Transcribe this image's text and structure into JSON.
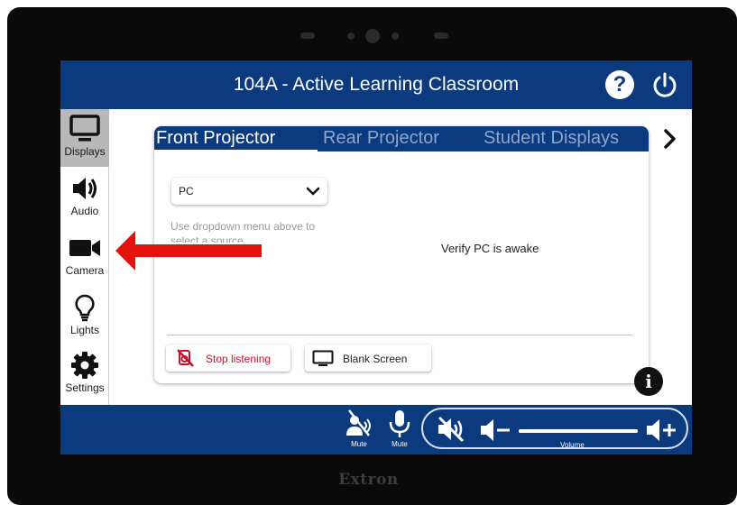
{
  "device": {
    "brand": "Extron"
  },
  "header": {
    "title": "104A - Active Learning Classroom",
    "help_label": "?"
  },
  "sidebar": {
    "items": [
      {
        "label": "Displays",
        "icon": "monitor-icon",
        "active": true
      },
      {
        "label": "Audio",
        "icon": "speaker-icon",
        "active": false
      },
      {
        "label": "Camera",
        "icon": "video-camera-icon",
        "active": false
      },
      {
        "label": "Lights",
        "icon": "lightbulb-icon",
        "active": false
      },
      {
        "label": "Settings",
        "icon": "gear-icon",
        "active": false
      }
    ]
  },
  "display_tabs": [
    {
      "label": "Front Projector",
      "active": true
    },
    {
      "label": "Rear Projector",
      "active": false
    },
    {
      "label": "Student Displays",
      "active": false
    }
  ],
  "source": {
    "selected": "PC",
    "hint": "Use dropdown menu above to select a source",
    "status": "Verify PC is awake"
  },
  "buttons": {
    "stop_listening": "Stop listening",
    "blank_screen": "Blank Screen"
  },
  "info_label": "i",
  "audio_bar": {
    "mic_group_label": "Mute",
    "mic_label": "Mute",
    "volume_label": "Volume",
    "volume_level": 1.0
  },
  "colors": {
    "brand_blue": "#0b3a7e",
    "stop_red": "#c8102e",
    "annotation_red": "#e3120b"
  }
}
